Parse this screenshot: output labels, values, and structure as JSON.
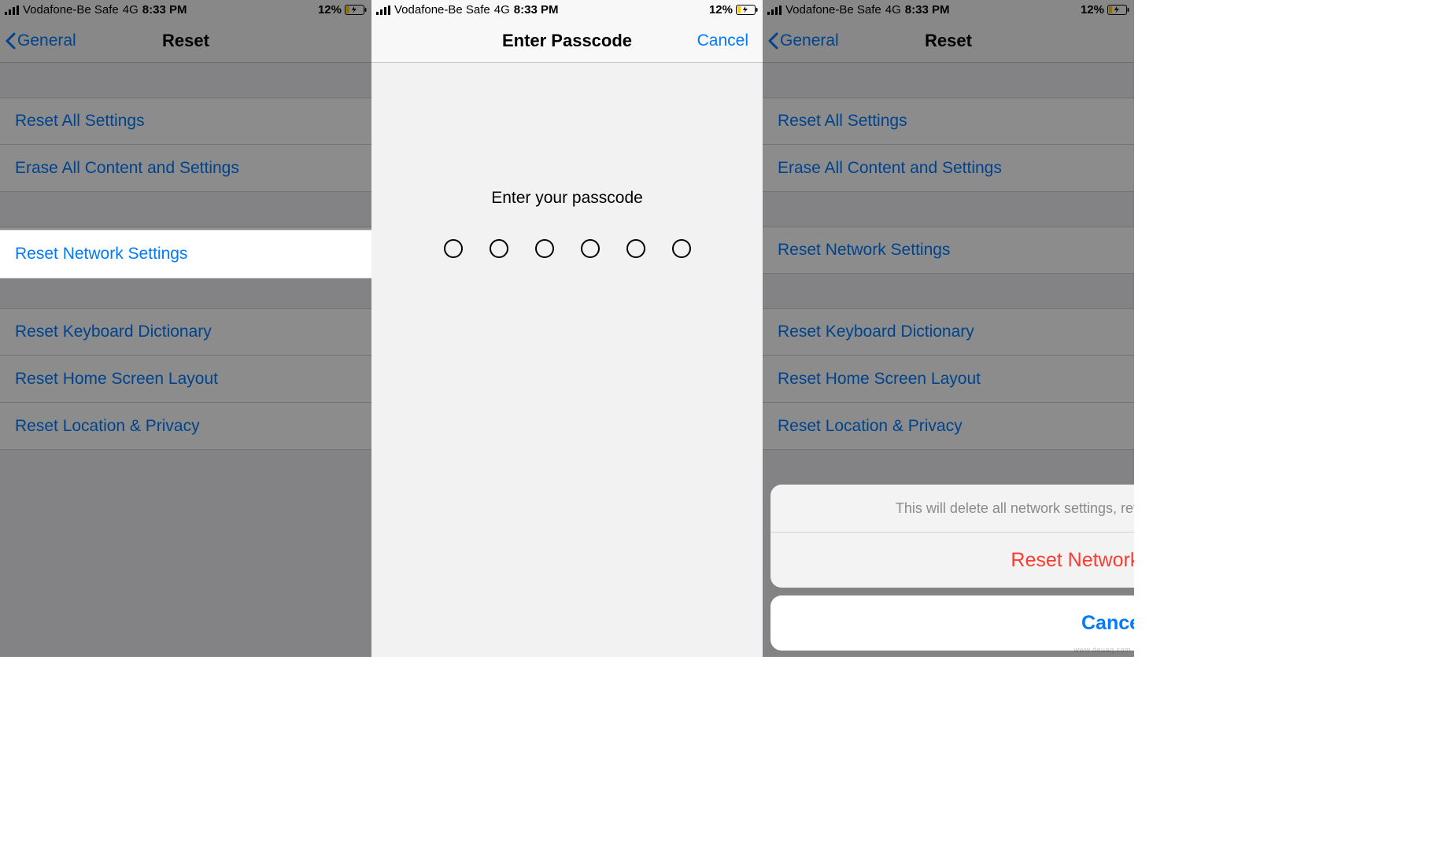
{
  "status": {
    "carrier": "Vodafone-Be Safe",
    "connection": "4G",
    "time": "8:33 PM",
    "battery_pct": "12%"
  },
  "screen1": {
    "nav": {
      "back_label": "General",
      "title": "Reset"
    },
    "cells": {
      "reset_all": "Reset All Settings",
      "erase_all": "Erase All Content and Settings",
      "reset_network": "Reset Network Settings",
      "reset_keyboard": "Reset Keyboard Dictionary",
      "reset_home": "Reset Home Screen Layout",
      "reset_location": "Reset Location & Privacy"
    }
  },
  "screen2": {
    "nav": {
      "title": "Enter Passcode",
      "cancel": "Cancel"
    },
    "prompt": "Enter your passcode",
    "passcode_length": 6
  },
  "screen3": {
    "nav": {
      "back_label": "General",
      "title": "Reset"
    },
    "cells": {
      "reset_all": "Reset All Settings",
      "erase_all": "Erase All Content and Settings",
      "reset_network": "Reset Network Settings",
      "reset_keyboard": "Reset Keyboard Dictionary",
      "reset_home": "Reset Home Screen Layout",
      "reset_location": "Reset Location & Privacy"
    },
    "sheet": {
      "message": "This will delete all network settings, returning them to factory defaults.",
      "confirm": "Reset Network Settings",
      "cancel": "Cancel"
    }
  },
  "watermark": "www.deuaq.com"
}
